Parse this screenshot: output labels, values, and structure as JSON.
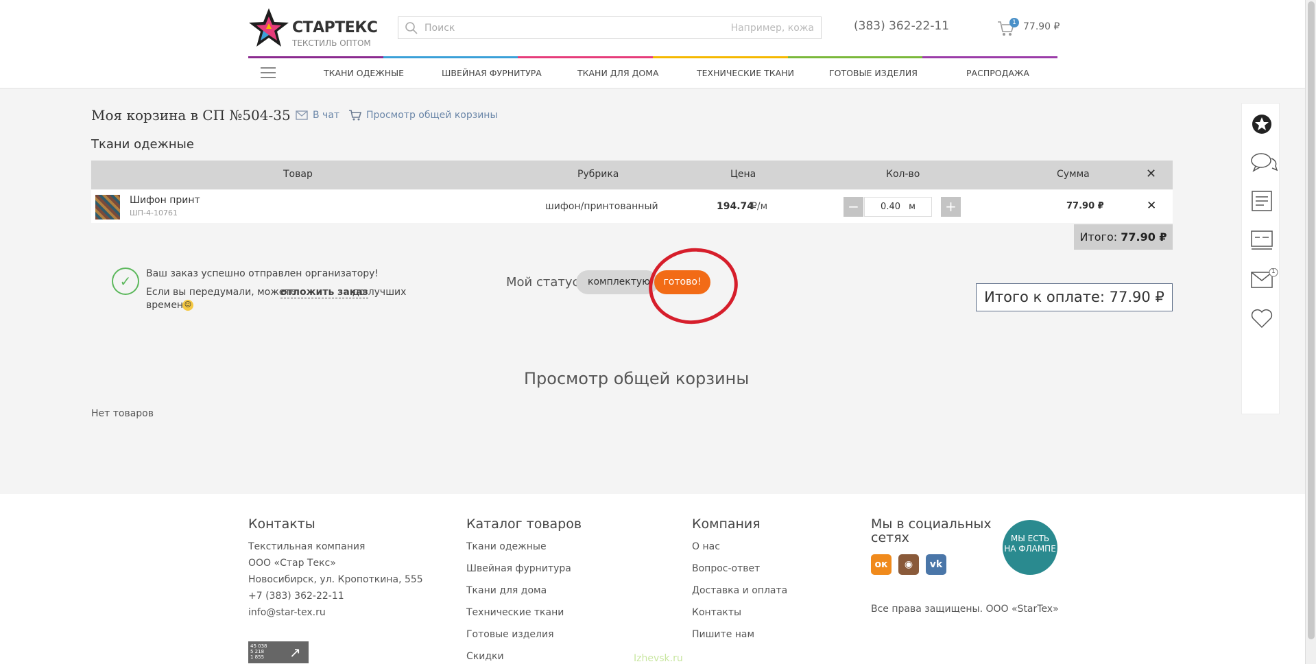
{
  "header": {
    "brand": "СТАРТЕКС",
    "tagline": "ТЕКСТИЛЬ ОПТОМ",
    "search_placeholder": "Поиск",
    "search_hint": "Например, кожа",
    "phone": "(383) 362-22-11",
    "cart_badge": "1",
    "cart_total": "77.90 ₽",
    "stripe_colors": [
      "#8b2a8f",
      "#3aa0d8",
      "#e63c7a",
      "#f5b800",
      "#7ab83a",
      "#9b3ca8"
    ]
  },
  "nav": {
    "items": [
      "ТКАНИ ОДЕЖНЫЕ",
      "ШВЕЙНАЯ ФУРНИТУРА",
      "ТКАНИ ДЛЯ ДОМА",
      "ТЕХНИЧЕСКИЕ ТКАНИ",
      "ГОТОВЫЕ ИЗДЕЛИЯ",
      "РАСПРОДАЖА"
    ]
  },
  "page": {
    "title": "Моя корзина в СП №504-35",
    "chat_link": "В чат",
    "view_all_link": "Просмотр общей корзины",
    "section": "Ткани одежные"
  },
  "table": {
    "columns": [
      "Товар",
      "Рубрика",
      "Цена",
      "Кол-во",
      "Сумма"
    ],
    "rows": [
      {
        "name": "Шифон принт",
        "sku": "ШП-4-10761",
        "category": "шифон/принтованный",
        "price": "194.74",
        "price_unit": "₽/м",
        "qty": "0.40",
        "qty_unit": "м",
        "sum": "77.90 ₽"
      }
    ],
    "total_label": "Итого:",
    "total_value": "77.90 ₽"
  },
  "order": {
    "success_line1": "Ваш заказ успешно отправлен организатору!",
    "success_line2_pre": "Если вы передумали, можете",
    "postpone_link": "отложить заказ",
    "success_line2_post": "до лучших",
    "success_line3": "времен",
    "status_label": "Мой статус:",
    "status_complect": "комплектую",
    "status_ready": "готово!",
    "pay_total": "Итого к оплате: 77.90 ₽"
  },
  "overall": {
    "title": "Просмотр общей корзины",
    "empty": "Нет товаров"
  },
  "side_panel": {
    "icons": [
      "logo-icon",
      "chat-icon",
      "document-icon",
      "card-icon",
      "mail-icon",
      "heart-icon"
    ],
    "mail_badge": "1"
  },
  "footer": {
    "contacts": {
      "title": "Контакты",
      "lines": [
        "Текстильная компания",
        "ООО «Стар Текс»",
        "Новосибирск, ул. Кропоткина, 555",
        "+7 (383) 362-22-11",
        "info@star-tex.ru"
      ]
    },
    "catalog": {
      "title": "Каталог товаров",
      "links": [
        "Ткани одежные",
        "Швейная фурнитура",
        "Ткани для дома",
        "Технические ткани",
        "Готовые изделия",
        "Скидки"
      ]
    },
    "company": {
      "title": "Компания",
      "links": [
        "О нас",
        "Вопрос-ответ",
        "Доставка и оплата",
        "Контакты",
        "Пишите нам"
      ]
    },
    "social": {
      "title_line1": "Мы в социальных",
      "title_line2": "сетях",
      "rights": "Все права защищены. ООО «StarTex»",
      "flamp_line1": "МЫ ЕСТЬ",
      "flamp_line2": "НА ФЛАМПЕ"
    },
    "counter_lines": [
      "45 038",
      "5 218",
      "1 855"
    ],
    "watermark": "Izhevsk.ru"
  }
}
